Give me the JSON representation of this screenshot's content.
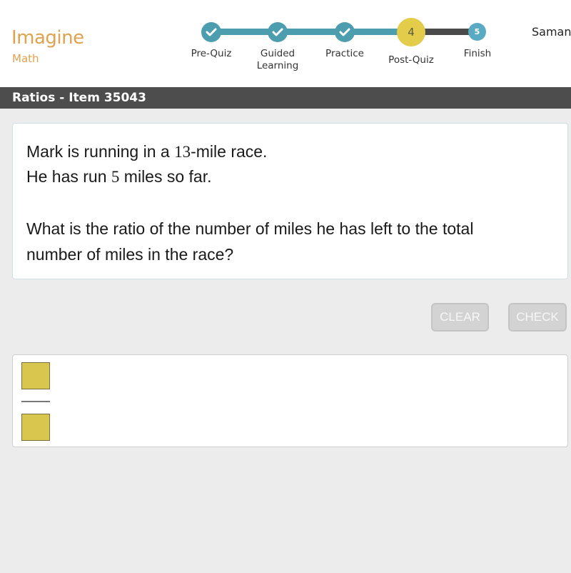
{
  "app": {
    "logo_main": "Imagine",
    "logo_sub": "Math",
    "user_name": "Saman"
  },
  "progress": {
    "steps": [
      {
        "label": "Pre-Quiz",
        "status": "complete",
        "icon": "check-icon"
      },
      {
        "label_line1": "Guided",
        "label_line2": "Learning",
        "status": "complete",
        "icon": "check-icon"
      },
      {
        "label": "Practice",
        "status": "complete",
        "icon": "check-icon"
      },
      {
        "label": "Post-Quiz",
        "status": "current",
        "number": "4"
      },
      {
        "label": "Finish",
        "status": "upcoming",
        "number": "5"
      }
    ]
  },
  "header": {
    "title": "Ratios - Item 35043"
  },
  "question": {
    "line1_pre": "Mark is running in a ",
    "line1_num": "13",
    "line1_post": "-mile race.",
    "line2_pre": "He has run ",
    "line2_num": "5",
    "line2_post": " miles so far.",
    "prompt_line1": "What is the ratio of the number of miles he has left to the total",
    "prompt_line2": "number of miles in the race?"
  },
  "actions": {
    "clear_label": "CLEAR",
    "check_label": "CHECK"
  },
  "answer": {
    "numerator": "",
    "denominator": ""
  },
  "colors": {
    "brand_orange": "#e0a24f",
    "step_done": "#4c9dad",
    "step_current": "#e2cc4a",
    "step_future": "#5aaac4",
    "title_bar": "#4d4d4d",
    "answer_box": "#d9c64f"
  }
}
